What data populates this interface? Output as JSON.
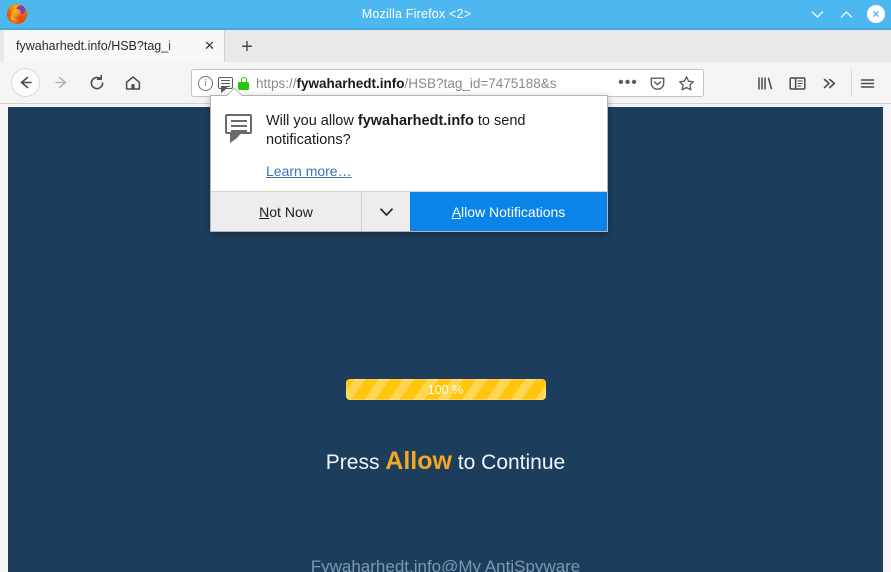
{
  "window": {
    "title": "Mozilla Firefox <2>",
    "app_icon": "firefox-logo",
    "controls": {
      "minimize": "⌄",
      "maximize": "⌃",
      "close": "×"
    },
    "titlebar_color": "#4db8ef"
  },
  "tabs": {
    "items": [
      {
        "title": "fywaharhedt.info/HSB?tag_i",
        "close_label": "✕"
      }
    ],
    "new_tab_label": "+"
  },
  "toolbar": {
    "back_icon": "←",
    "forward_icon": "→",
    "reload_icon": "↻",
    "home_icon": "⌂",
    "library_icon": "library-icon",
    "sidebar_icon": "sidebar-icon",
    "overflow_icon": "»",
    "menu_icon": "≡"
  },
  "urlbar": {
    "scheme": "https://",
    "host": "fywaharhedt.info",
    "path": "/HSB?tag_id=7475188&s",
    "identity_icons": [
      "info-icon",
      "notification-bubble-icon",
      "lock-icon"
    ],
    "lock_color": "#2ac214",
    "page_actions": {
      "meatball": "•••",
      "pocket": "pocket-icon",
      "bookmark": "☆"
    }
  },
  "permission_popup": {
    "icon": "notification-bubble-icon",
    "question_prefix": "Will you allow ",
    "question_host": "fywaharhedt.info",
    "question_suffix": " to send notifications?",
    "learn_more": "Learn more…",
    "not_now_label": "Not Now",
    "not_now_accesskey": "N",
    "dropdown_icon": "⌄",
    "allow_label": "Allow Notifications",
    "allow_accesskey": "A",
    "allow_color": "#0a84e8"
  },
  "page": {
    "background_color": "#1d3d5c",
    "progress": {
      "value": 100,
      "label": "100 %",
      "bar_color": "#ffc50f"
    },
    "headline_prefix": "Press ",
    "headline_keyword": "Allow",
    "headline_suffix": " to Continue",
    "keyword_color": "#f5a623",
    "footer_brand": "Fywaharhedt.info@My AntiSpyware"
  }
}
